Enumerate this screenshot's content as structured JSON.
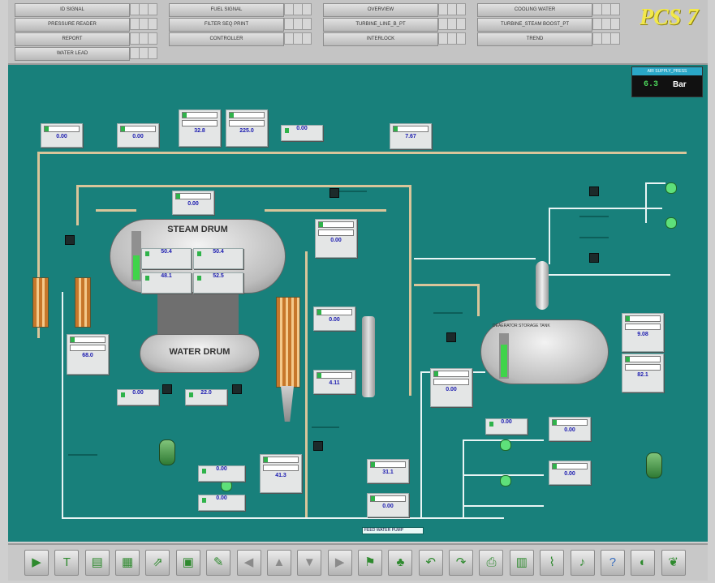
{
  "header": {
    "logo": "PCS 7",
    "nav_buttons": [
      {
        "label": "ID SIGNAL",
        "col": 0,
        "row": 0
      },
      {
        "label": "PRESSURE READER",
        "col": 0,
        "row": 1
      },
      {
        "label": "REPORT",
        "col": 0,
        "row": 2
      },
      {
        "label": "WATER LEAD",
        "col": 0,
        "row": 3
      },
      {
        "label": "FUEL SIGNAL",
        "col": 1,
        "row": 0
      },
      {
        "label": "FILTER SEQ PRINT",
        "col": 1,
        "row": 1
      },
      {
        "label": "CONTROLLER",
        "col": 1,
        "row": 2
      },
      {
        "label": "OVERVIEW",
        "col": 2,
        "row": 0
      },
      {
        "label": "TURBINE_LINE_B_PT",
        "col": 2,
        "row": 1
      },
      {
        "label": "INTERLOCK",
        "col": 2,
        "row": 2
      },
      {
        "label": "COOLING WATER",
        "col": 3,
        "row": 0
      },
      {
        "label": "TURBINE_STEAM BOOST_PT",
        "col": 3,
        "row": 1
      },
      {
        "label": "TREND",
        "col": 3,
        "row": 2
      }
    ]
  },
  "readout": {
    "title": "AIR SUPPLY_PRESS",
    "value": "6.3",
    "unit": "Bar"
  },
  "process": {
    "steam_drum_label": "STEAM DRUM",
    "water_drum_label": "WATER DRUM",
    "storage_tank_label": "DEAERATOR STORAGE TANK",
    "feed_label": "FEED WATER PUMP"
  },
  "faceplates": [
    {
      "id": "fp1",
      "val": "0.00"
    },
    {
      "id": "fp2",
      "val": "0.00"
    },
    {
      "id": "fp3",
      "val": "32.8"
    },
    {
      "id": "fp4",
      "val": "225.0"
    },
    {
      "id": "fp5",
      "val": "0.00"
    },
    {
      "id": "fp6",
      "val": "7.67"
    },
    {
      "id": "fp7",
      "val": "0.00"
    },
    {
      "id": "fp8",
      "val": "0.00"
    },
    {
      "id": "fp9",
      "val": "50.4"
    },
    {
      "id": "fp10",
      "val": "50.4"
    },
    {
      "id": "fp11",
      "val": "48.1"
    },
    {
      "id": "fp12",
      "val": "52.5"
    },
    {
      "id": "fp13",
      "val": "0.00"
    },
    {
      "id": "fp14",
      "val": "4.11"
    },
    {
      "id": "fp15",
      "val": "68.0"
    },
    {
      "id": "fp16",
      "val": "0.00"
    },
    {
      "id": "fp17",
      "val": "22.0"
    },
    {
      "id": "fp18",
      "val": "0.00"
    },
    {
      "id": "fp19",
      "val": "41.3"
    },
    {
      "id": "fp20",
      "val": "0.00"
    },
    {
      "id": "fp21",
      "val": "0.00"
    },
    {
      "id": "fp22",
      "val": "31.1"
    },
    {
      "id": "fp23",
      "val": "0.00"
    },
    {
      "id": "fp24",
      "val": "0.00"
    },
    {
      "id": "fp25",
      "val": "9.08"
    },
    {
      "id": "fp26",
      "val": "82.1"
    },
    {
      "id": "fp27",
      "val": "0.00"
    },
    {
      "id": "fp28",
      "val": "0.00"
    }
  ],
  "toolbar": {
    "items": [
      {
        "icon": "play-icon",
        "glyph": "▶"
      },
      {
        "icon": "text-icon",
        "glyph": "T"
      },
      {
        "icon": "note-icon",
        "glyph": "▤"
      },
      {
        "icon": "doc-icon",
        "glyph": "▦"
      },
      {
        "icon": "chart-icon",
        "glyph": "⇗"
      },
      {
        "icon": "sheet-icon",
        "glyph": "▣"
      },
      {
        "icon": "edit-icon",
        "glyph": "✎"
      },
      {
        "icon": "nav-left-icon",
        "glyph": "◀"
      },
      {
        "icon": "nav-up-icon",
        "glyph": "▲"
      },
      {
        "icon": "nav-down-icon",
        "glyph": "▼"
      },
      {
        "icon": "nav-right-icon",
        "glyph": "▶"
      },
      {
        "icon": "tag-icon",
        "glyph": "⚑"
      },
      {
        "icon": "tree-icon",
        "glyph": "♣"
      },
      {
        "icon": "back-icon",
        "glyph": "↶"
      },
      {
        "icon": "forward-icon",
        "glyph": "↷"
      },
      {
        "icon": "print-icon",
        "glyph": "⎙"
      },
      {
        "icon": "view-icon",
        "glyph": "▥"
      },
      {
        "icon": "plot-icon",
        "glyph": "⌇"
      },
      {
        "icon": "sound-icon",
        "glyph": "♪"
      },
      {
        "icon": "help-icon",
        "glyph": "?"
      },
      {
        "icon": "speaker-icon",
        "glyph": "◐"
      },
      {
        "icon": "logo-icon",
        "glyph": "❦"
      }
    ]
  }
}
